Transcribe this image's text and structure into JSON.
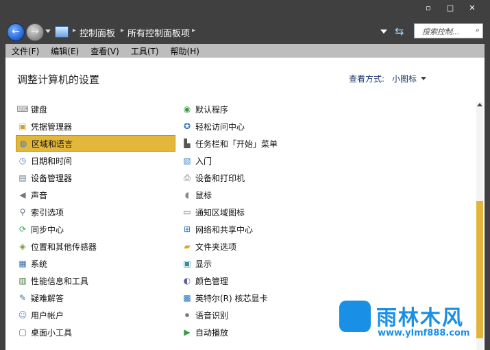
{
  "window": {
    "minimize": "▫",
    "maximize": "□",
    "close": "✕"
  },
  "nav": {
    "breadcrumbs": [
      "控制面板",
      "所有控制面板项"
    ],
    "search_placeholder": "搜索控制...",
    "search_icon": "⌕"
  },
  "menubar": [
    "文件(F)",
    "编辑(E)",
    "查看(V)",
    "工具(T)",
    "帮助(H)"
  ],
  "content": {
    "title": "调整计算机的设置",
    "view_label": "查看方式:",
    "view_value": "小图标"
  },
  "left_items": [
    {
      "label": "键盘",
      "icon": "keyboard-icon",
      "glyph": "⌨",
      "color": "#8a8a8a"
    },
    {
      "label": "凭据管理器",
      "icon": "credential-manager-icon",
      "glyph": "▣",
      "color": "#c9a23a"
    },
    {
      "label": "区域和语言",
      "icon": "globe-icon",
      "glyph": "◍",
      "color": "#2e7bd0",
      "selected": true
    },
    {
      "label": "日期和时间",
      "icon": "calendar-clock-icon",
      "glyph": "◷",
      "color": "#4a84c8"
    },
    {
      "label": "设备管理器",
      "icon": "device-manager-icon",
      "glyph": "▤",
      "color": "#6a7b8c"
    },
    {
      "label": "声音",
      "icon": "speaker-icon",
      "glyph": "◀",
      "color": "#777"
    },
    {
      "label": "索引选项",
      "icon": "index-search-icon",
      "glyph": "⚲",
      "color": "#5a6a7a"
    },
    {
      "label": "同步中心",
      "icon": "sync-icon",
      "glyph": "⟳",
      "color": "#2fa84f"
    },
    {
      "label": "位置和其他传感器",
      "icon": "sensor-icon",
      "glyph": "◈",
      "color": "#7a9a3a"
    },
    {
      "label": "系统",
      "icon": "system-icon",
      "glyph": "▦",
      "color": "#3a6fb5"
    },
    {
      "label": "性能信息和工具",
      "icon": "performance-icon",
      "glyph": "▥",
      "color": "#4a7a3a"
    },
    {
      "label": "疑难解答",
      "icon": "troubleshoot-icon",
      "glyph": "✎",
      "color": "#4a6a9a"
    },
    {
      "label": "用户帐户",
      "icon": "user-accounts-icon",
      "glyph": "☺",
      "color": "#5a86c0"
    },
    {
      "label": "桌面小工具",
      "icon": "gadgets-icon",
      "glyph": "▢",
      "color": "#3a5f8f"
    }
  ],
  "right_items": [
    {
      "label": "默认程序",
      "icon": "default-programs-icon",
      "glyph": "◉",
      "color": "#3a9a4a"
    },
    {
      "label": "轻松访问中心",
      "icon": "ease-of-access-icon",
      "glyph": "✪",
      "color": "#2f6fbf"
    },
    {
      "label": "任务栏和「开始」菜单",
      "icon": "taskbar-icon",
      "glyph": "▙",
      "color": "#555"
    },
    {
      "label": "入门",
      "icon": "getting-started-icon",
      "glyph": "▧",
      "color": "#3a8ad0"
    },
    {
      "label": "设备和打印机",
      "icon": "printer-icon",
      "glyph": "⎙",
      "color": "#666"
    },
    {
      "label": "鼠标",
      "icon": "mouse-icon",
      "glyph": "◖",
      "color": "#888"
    },
    {
      "label": "通知区域图标",
      "icon": "notification-icon",
      "glyph": "▭",
      "color": "#4a6a8a"
    },
    {
      "label": "网络和共享中心",
      "icon": "network-icon",
      "glyph": "⊞",
      "color": "#3a7ac0"
    },
    {
      "label": "文件夹选项",
      "icon": "folder-options-icon",
      "glyph": "▰",
      "color": "#d6a731"
    },
    {
      "label": "显示",
      "icon": "display-icon",
      "glyph": "▣",
      "color": "#3a8a9a"
    },
    {
      "label": "颜色管理",
      "icon": "color-management-icon",
      "glyph": "◐",
      "color": "#5a5aa0"
    },
    {
      "label": "英特尔(R) 核芯显卡",
      "icon": "intel-graphics-icon",
      "glyph": "▩",
      "color": "#1a6fc0"
    },
    {
      "label": "语音识别",
      "icon": "microphone-icon",
      "glyph": "⏺",
      "color": "#777"
    },
    {
      "label": "自动播放",
      "icon": "autoplay-icon",
      "glyph": "▶",
      "color": "#3a9a4a"
    }
  ],
  "watermark": {
    "text": "雨林木风",
    "url": "www.ylmf888.com"
  }
}
